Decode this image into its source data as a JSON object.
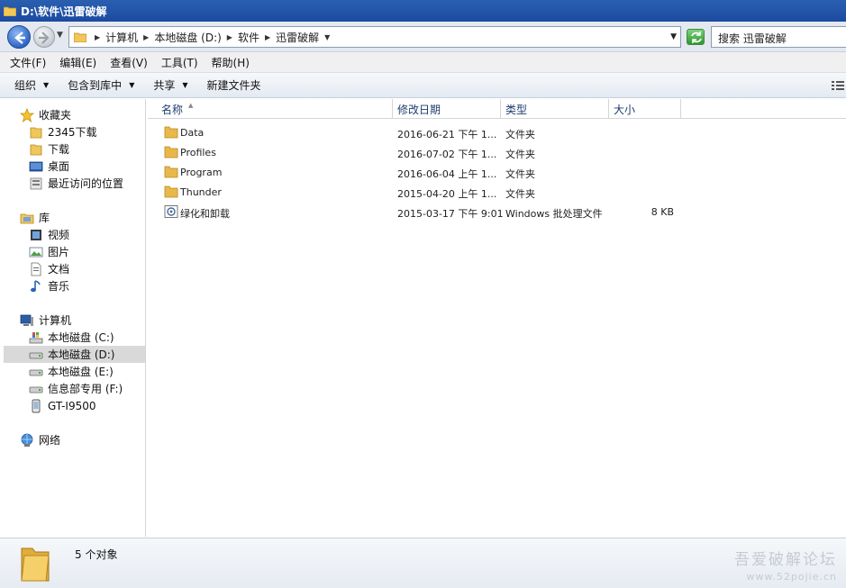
{
  "window": {
    "title": "D:\\软件\\迅雷破解"
  },
  "address": {
    "crumbs": [
      "计算机",
      "本地磁盘 (D:)",
      "软件",
      "迅雷破解"
    ],
    "search_placeholder": "搜索 迅雷破解"
  },
  "menu": [
    "文件(F)",
    "编辑(E)",
    "查看(V)",
    "工具(T)",
    "帮助(H)"
  ],
  "toolbar": {
    "organize": "组织",
    "include_library": "包含到库中",
    "share": "共享",
    "new_folder": "新建文件夹"
  },
  "sidebar": {
    "favorites": {
      "label": "收藏夹",
      "items": [
        "2345下载",
        "下载",
        "桌面",
        "最近访问的位置"
      ]
    },
    "libraries": {
      "label": "库",
      "items": [
        "视频",
        "图片",
        "文档",
        "音乐"
      ]
    },
    "computer": {
      "label": "计算机",
      "items": [
        "本地磁盘 (C:)",
        "本地磁盘 (D:)",
        "本地磁盘 (E:)",
        "信息部专用 (F:)",
        "GT-I9500"
      ],
      "selected": "本地磁盘 (D:)"
    },
    "network": {
      "label": "网络"
    }
  },
  "columns": {
    "name": "名称",
    "date": "修改日期",
    "type": "类型",
    "size": "大小"
  },
  "files": [
    {
      "name": "Data",
      "date": "2016-06-21 下午 1...",
      "type": "文件夹",
      "size": "",
      "icon": "folder-icon"
    },
    {
      "name": "Profiles",
      "date": "2016-07-02 下午 1...",
      "type": "文件夹",
      "size": "",
      "icon": "folder-icon"
    },
    {
      "name": "Program",
      "date": "2016-06-04 上午 1...",
      "type": "文件夹",
      "size": "",
      "icon": "folder-icon"
    },
    {
      "name": "Thunder",
      "date": "2015-04-20 上午 1...",
      "type": "文件夹",
      "size": "",
      "icon": "folder-icon"
    },
    {
      "name": "绿化和卸载",
      "date": "2015-03-17 下午 9:01",
      "type": "Windows 批处理文件",
      "size": "8 KB",
      "icon": "batch-file-icon"
    }
  ],
  "status": {
    "count": "5 个对象"
  },
  "watermark": {
    "line1": "吾爱破解论坛",
    "line2": "www.52pojie.cn"
  },
  "colors": {
    "title_bar": "#1c4aa0",
    "toolbar": "#e4eaf2",
    "selected_row": "#d9d9d9",
    "folder": "#e8b94a"
  }
}
